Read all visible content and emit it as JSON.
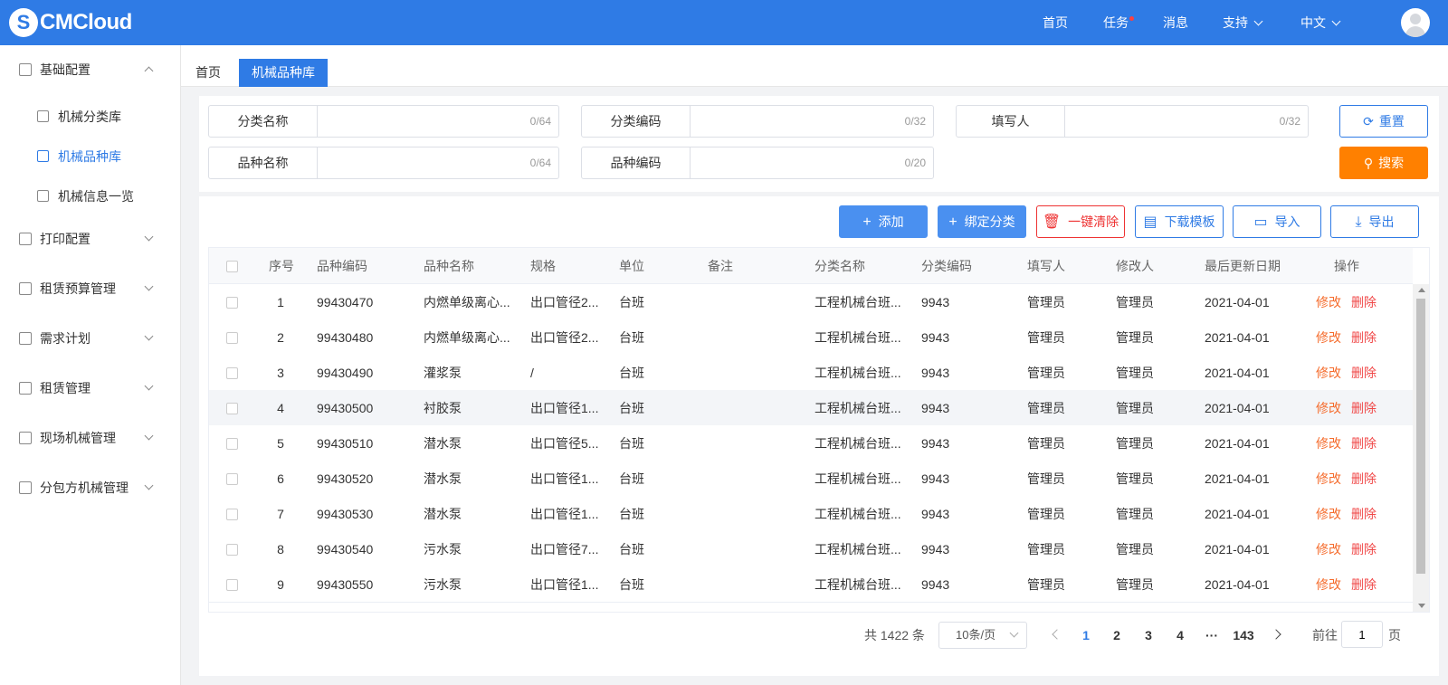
{
  "header": {
    "logo_text": "CMCloud",
    "logo_mark": "S",
    "nav": [
      {
        "label": "首页"
      },
      {
        "label": "任务",
        "has_dot": true
      },
      {
        "label": "消息"
      },
      {
        "label": "支持",
        "dropdown": true
      },
      {
        "label": "中文",
        "dropdown": true
      }
    ]
  },
  "sidebar": {
    "items": [
      {
        "label": "基础配置",
        "icon": "grid-icon",
        "expanded": true,
        "children": [
          {
            "label": "机械分类库",
            "icon": "hierarchy-icon"
          },
          {
            "label": "机械品种库",
            "icon": "database-icon",
            "active": true
          },
          {
            "label": "机械信息一览",
            "icon": "document-icon"
          }
        ]
      },
      {
        "label": "打印配置",
        "icon": "layers-icon"
      },
      {
        "label": "租赁预算管理",
        "icon": "budget-icon"
      },
      {
        "label": "需求计划",
        "icon": "yen-icon"
      },
      {
        "label": "租赁管理",
        "icon": "hierarchy-icon"
      },
      {
        "label": "现场机械管理",
        "icon": "machine-icon"
      },
      {
        "label": "分包方机械管理",
        "icon": "excavator-icon"
      }
    ]
  },
  "tabs": [
    {
      "label": "首页"
    },
    {
      "label": "机械品种库",
      "active": true
    }
  ],
  "filters": {
    "category_name": {
      "label": "分类名称",
      "count": "0/64"
    },
    "category_code": {
      "label": "分类编码",
      "count": "0/32"
    },
    "filler": {
      "label": "填写人",
      "count": "0/32"
    },
    "variety_name": {
      "label": "品种名称",
      "count": "0/64"
    },
    "variety_code": {
      "label": "品种编码",
      "count": "0/20"
    },
    "reset_label": "重置",
    "search_label": "搜索"
  },
  "toolbar": {
    "add": "添加",
    "bind": "绑定分类",
    "clear": "一键清除",
    "download": "下载模板",
    "import": "导入",
    "export": "导出"
  },
  "table": {
    "columns": [
      "序号",
      "品种编码",
      "品种名称",
      "规格",
      "单位",
      "备注",
      "分类名称",
      "分类编码",
      "填写人",
      "修改人",
      "最后更新日期",
      "操作"
    ],
    "rows": [
      {
        "no": "1",
        "code": "99430470",
        "name": "内燃单级离心...",
        "spec": "出口管径2...",
        "unit": "台班",
        "note": "",
        "cat": "工程机械台班...",
        "cat_code": "9943",
        "filler": "管理员",
        "editor": "管理员",
        "date": "2021-04-01"
      },
      {
        "no": "2",
        "code": "99430480",
        "name": "内燃单级离心...",
        "spec": "出口管径2...",
        "unit": "台班",
        "note": "",
        "cat": "工程机械台班...",
        "cat_code": "9943",
        "filler": "管理员",
        "editor": "管理员",
        "date": "2021-04-01"
      },
      {
        "no": "3",
        "code": "99430490",
        "name": "灌浆泵",
        "spec": "/",
        "unit": "台班",
        "note": "",
        "cat": "工程机械台班...",
        "cat_code": "9943",
        "filler": "管理员",
        "editor": "管理员",
        "date": "2021-04-01"
      },
      {
        "no": "4",
        "code": "99430500",
        "name": "衬胶泵",
        "spec": "出口管径1...",
        "unit": "台班",
        "note": "",
        "cat": "工程机械台班...",
        "cat_code": "9943",
        "filler": "管理员",
        "editor": "管理员",
        "date": "2021-04-01"
      },
      {
        "no": "5",
        "code": "99430510",
        "name": "潜水泵",
        "spec": "出口管径5...",
        "unit": "台班",
        "note": "",
        "cat": "工程机械台班...",
        "cat_code": "9943",
        "filler": "管理员",
        "editor": "管理员",
        "date": "2021-04-01"
      },
      {
        "no": "6",
        "code": "99430520",
        "name": "潜水泵",
        "spec": "出口管径1...",
        "unit": "台班",
        "note": "",
        "cat": "工程机械台班...",
        "cat_code": "9943",
        "filler": "管理员",
        "editor": "管理员",
        "date": "2021-04-01"
      },
      {
        "no": "7",
        "code": "99430530",
        "name": "潜水泵",
        "spec": "出口管径1...",
        "unit": "台班",
        "note": "",
        "cat": "工程机械台班...",
        "cat_code": "9943",
        "filler": "管理员",
        "editor": "管理员",
        "date": "2021-04-01"
      },
      {
        "no": "8",
        "code": "99430540",
        "name": "污水泵",
        "spec": "出口管径7...",
        "unit": "台班",
        "note": "",
        "cat": "工程机械台班...",
        "cat_code": "9943",
        "filler": "管理员",
        "editor": "管理员",
        "date": "2021-04-01"
      },
      {
        "no": "9",
        "code": "99430550",
        "name": "污水泵",
        "spec": "出口管径1...",
        "unit": "台班",
        "note": "",
        "cat": "工程机械台班...",
        "cat_code": "9943",
        "filler": "管理员",
        "editor": "管理员",
        "date": "2021-04-01"
      }
    ],
    "op_edit": "修改",
    "op_delete": "删除"
  },
  "pagination": {
    "total": "共 1422 条",
    "page_size": "10条/页",
    "pages": [
      "1",
      "2",
      "3",
      "4",
      "···",
      "143"
    ],
    "current": "1",
    "goto_label": "前往",
    "goto_value": "1",
    "goto_unit": "页"
  },
  "colors": {
    "primary": "#2f7be5",
    "orange": "#ff8000",
    "danger": "#f04848"
  }
}
